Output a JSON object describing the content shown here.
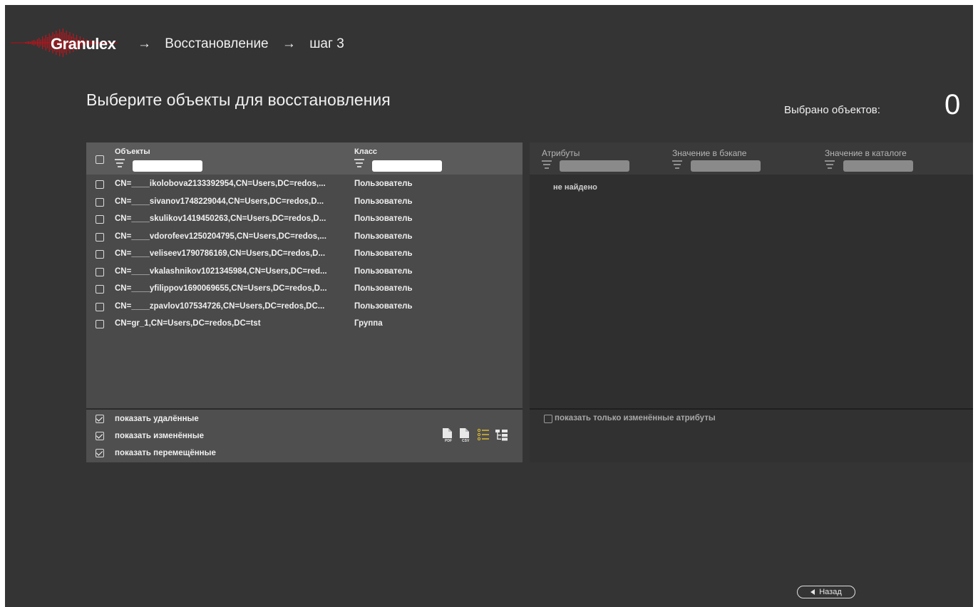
{
  "app": {
    "name": "Granulex"
  },
  "header": {
    "breadcrumbs": [
      "Восстановление",
      "шаг 3"
    ]
  },
  "page": {
    "title": "Выберите объекты для восстановления",
    "selected_label": "Выбрано объектов:",
    "selected_count": "0"
  },
  "objects_table": {
    "columns": {
      "objects": "Объекты",
      "class": "Класс"
    },
    "filters": {
      "objects": "",
      "class": ""
    },
    "rows": [
      {
        "object": "CN=____ikolobova2133392954,CN=Users,DC=redos,...",
        "class": "Пользователь"
      },
      {
        "object": "CN=____sivanov1748229044,CN=Users,DC=redos,D...",
        "class": "Пользователь"
      },
      {
        "object": "CN=____skulikov1419450263,CN=Users,DC=redos,D...",
        "class": "Пользователь"
      },
      {
        "object": "CN=____vdorofeev1250204795,CN=Users,DC=redos,...",
        "class": "Пользователь"
      },
      {
        "object": "CN=____veliseev1790786169,CN=Users,DC=redos,D...",
        "class": "Пользователь"
      },
      {
        "object": "CN=____vkalashnikov1021345984,CN=Users,DC=red...",
        "class": "Пользователь"
      },
      {
        "object": "CN=____yfilippov1690069655,CN=Users,DC=redos,D...",
        "class": "Пользователь"
      },
      {
        "object": "CN=____zpavlov107534726,CN=Users,DC=redos,DC...",
        "class": "Пользователь"
      },
      {
        "object": "CN=gr_1,CN=Users,DC=redos,DC=tst",
        "class": "Группа"
      }
    ]
  },
  "options": {
    "show_deleted": "показать удалённые",
    "show_changed": "показать изменённые",
    "show_moved": "показать перемещённые"
  },
  "toolbar_icons": [
    "pdf-export-icon",
    "csv-export-icon",
    "list-view-icon",
    "tree-view-icon"
  ],
  "attributes_table": {
    "columns": {
      "attributes": "Атрибуты",
      "backup_value": "Значение в бэкапе",
      "catalog_value": "Значение в каталоге"
    },
    "empty_text": "не найдено",
    "only_changed": "показать только изменённые атрибуты"
  },
  "footer": {
    "back_label": "Назад"
  },
  "colors": {
    "logo_red": "#c0141c",
    "accent_yellow": "#e8c22e",
    "background": "#343434"
  }
}
